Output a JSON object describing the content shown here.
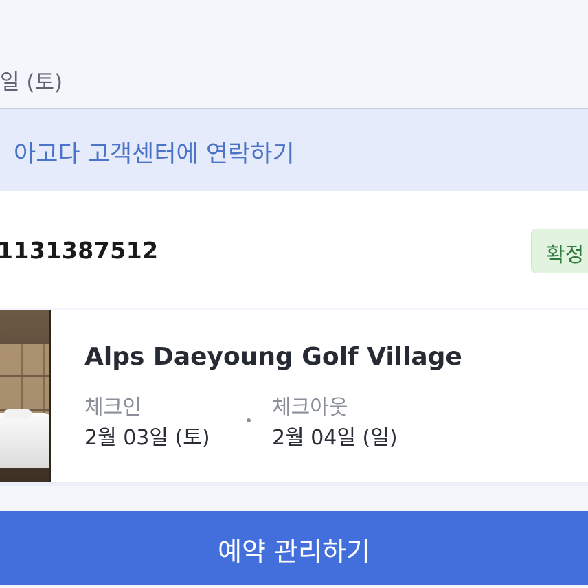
{
  "top": {
    "date_fragment": "일 (토)"
  },
  "contact": {
    "label": "아고다 고객센터에 연락하기"
  },
  "booking": {
    "id_fragment": "1131387512",
    "status": "확정",
    "status_color": "#2f7a3e"
  },
  "hotel": {
    "name": "Alps Daeyoung Golf Village",
    "checkin_label": "체크인",
    "checkin_date": "2월 03일 (토)",
    "checkout_label": "체크아웃",
    "checkout_date": "2월 04일 (일)"
  },
  "actions": {
    "manage_label": "예약 관리하기",
    "accent": "#436fdd"
  }
}
